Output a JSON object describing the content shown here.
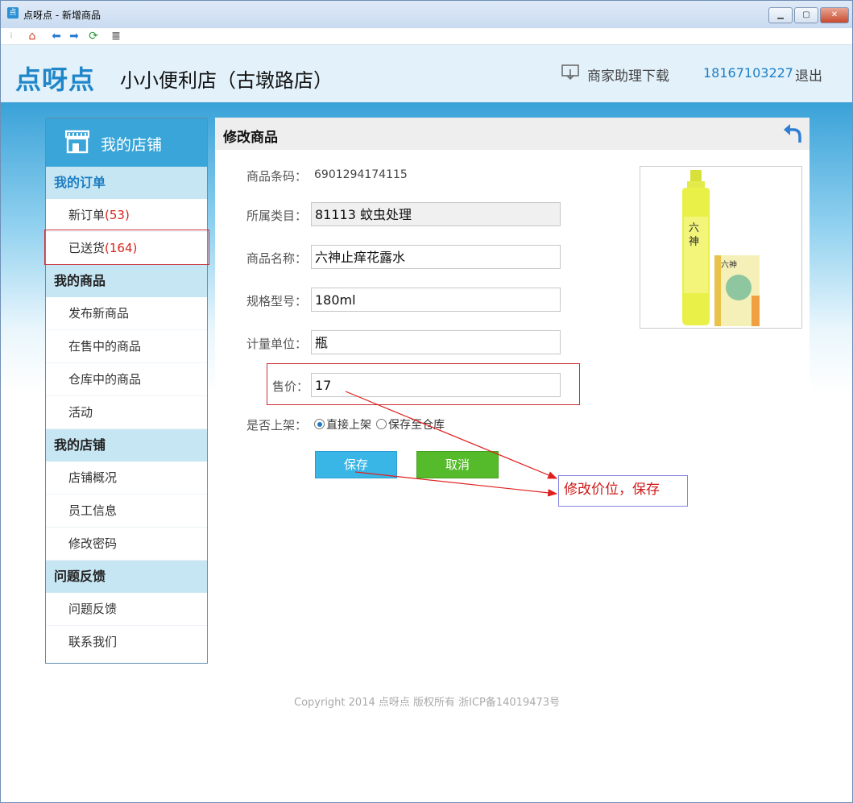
{
  "window": {
    "title": "点呀点 - 新增商品",
    "app_icon": "点"
  },
  "header": {
    "logo": "点呀点",
    "shop_name": "小小便利店（古墩路店）",
    "download_label": "商家助理下载",
    "phone": "18167103227",
    "logout_label": "退出"
  },
  "sidebar": {
    "title": "我的店铺",
    "sections": [
      {
        "label": "我的订单",
        "items": [
          {
            "label": "新订单",
            "count": "(53)"
          },
          {
            "label": "已送货",
            "count": "(164)"
          }
        ]
      },
      {
        "label": "我的商品",
        "items": [
          {
            "label": "发布新商品"
          },
          {
            "label": "在售中的商品"
          },
          {
            "label": "仓库中的商品"
          },
          {
            "label": "活动"
          }
        ]
      },
      {
        "label": "我的店铺",
        "items": [
          {
            "label": "店铺概况"
          },
          {
            "label": "员工信息"
          },
          {
            "label": "修改密码"
          }
        ]
      },
      {
        "label": "问题反馈",
        "items": [
          {
            "label": "问题反馈"
          },
          {
            "label": "联系我们"
          }
        ]
      }
    ]
  },
  "form": {
    "title": "修改商品",
    "barcode_label": "商品条码：",
    "barcode_value": "6901294174115",
    "category_label": "所属类目：",
    "category_value": "81113 蚊虫处理",
    "name_label": "商品名称：",
    "name_value": "六神止痒花露水",
    "spec_label": "规格型号：",
    "spec_value": "180ml",
    "unit_label": "计量单位：",
    "unit_value": "瓶",
    "price_label": "售价：",
    "price_value": "17",
    "shelf_label": "是否上架：",
    "shelf_options": [
      "直接上架",
      "保存至仓库"
    ],
    "shelf_selected": "直接上架",
    "save_label": "保存",
    "cancel_label": "取消"
  },
  "annotation": {
    "text": "修改价位，保存"
  },
  "footer": {
    "copyright": "Copyright 2014 点呀点 版权所有 浙ICP备14019473号"
  },
  "colors": {
    "brand": "#1f86c9",
    "highlight_border": "#c9303a",
    "arrow": "#e0201e",
    "save_button": "#3ab6e6",
    "cancel_button": "#55bb2a"
  },
  "icons": [
    "home-icon",
    "back-arrow-icon",
    "forward-arrow-icon",
    "refresh-icon",
    "menu-icon",
    "download-icon",
    "store-icon",
    "return-icon"
  ]
}
